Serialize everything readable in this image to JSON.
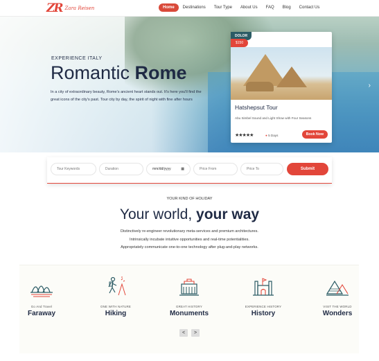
{
  "brand": {
    "mark": "ZR",
    "name": "Zara Reisen"
  },
  "nav": {
    "items": [
      {
        "label": "Home"
      },
      {
        "label": "Destinations"
      },
      {
        "label": "Tour Type"
      },
      {
        "label": "About Us"
      },
      {
        "label": "FAQ"
      },
      {
        "label": "Blog"
      },
      {
        "label": "Contact Us"
      }
    ],
    "active": "Home"
  },
  "hero": {
    "eyebrow": "EXPERIENCE ITALY",
    "title_plain": "Romantic ",
    "title_highlight": "Rome",
    "description": "In a city of extraordinary beauty, Rome's ancient heart stands out. It's here you'll find the great icons of the city's past. Tour city by day, the spirit of night with fine after hours"
  },
  "tour_card": {
    "badge": "DOLOR",
    "price": "$150",
    "name": "Hatshepsut Tour",
    "subtitle": "Abu Simbel Sound and Light Show with Four Seasons",
    "stars": "★★★★★",
    "days": "5 Days",
    "button": "Book Now"
  },
  "search": {
    "keywords_placeholder": "Tour Keywords",
    "duration_placeholder": "Duration",
    "date_value": "mm/dd/yyyy",
    "price_from_placeholder": "Price From",
    "price_to_placeholder": "Price To",
    "submit": "Submit"
  },
  "intro": {
    "eyebrow": "YOUR KIND OF HOLIDAY",
    "title_plain": "Your world, ",
    "title_highlight": "your way",
    "lines": [
      "Distinctively re-engineer revolutionary meta-services and premium architectures.",
      "Intrinsically incubate intuitive opportunities and real-time potentialities.",
      "Appropriately communicate one-to-one technology after plug-and-play networks."
    ]
  },
  "categories": [
    {
      "small": "Go And Travel",
      "big": "Faraway",
      "icon": "opera-house-icon"
    },
    {
      "small": "ONE WITH NATURE",
      "big": "Hiking",
      "icon": "hiker-icon"
    },
    {
      "small": "GREAT HISTORY",
      "big": "Monuments",
      "icon": "monument-icon"
    },
    {
      "small": "EXPERIENCE HISTORY",
      "big": "History",
      "icon": "castle-icon"
    },
    {
      "small": "VISIT THE WORLD",
      "big": "Wonders",
      "icon": "pyramids-icon"
    }
  ],
  "pager": {
    "prev": "<",
    "next": ">"
  },
  "colors": {
    "accent": "#e2463a",
    "navy": "#1f2a44",
    "teal": "#2b5b65"
  }
}
